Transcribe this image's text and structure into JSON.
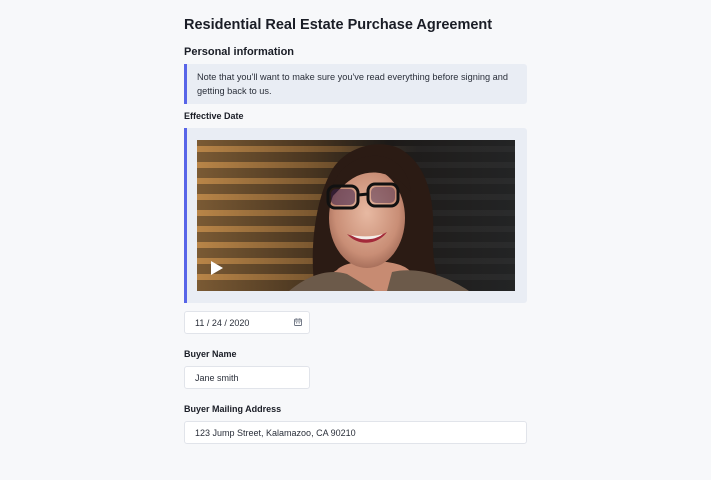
{
  "form": {
    "title": "Residential Real Estate Purchase Agreement",
    "section_title": "Personal information",
    "note": "Note that you'll want to make sure you've read everything before signing and getting back to us.",
    "effective_date": {
      "label": "Effective Date",
      "value": "11 / 24 / 2020",
      "icon": "calendar-icon"
    },
    "video": {
      "icon": "play-icon"
    },
    "buyer_name": {
      "label": "Buyer Name",
      "value": "Jane smith"
    },
    "buyer_address": {
      "label": "Buyer Mailing Address",
      "value": "123 Jump Street, Kalamazoo, CA 90210"
    }
  },
  "colors": {
    "accent": "#5865e8",
    "note_background": "#e9edf4",
    "page_background": "#f7f8fa"
  }
}
